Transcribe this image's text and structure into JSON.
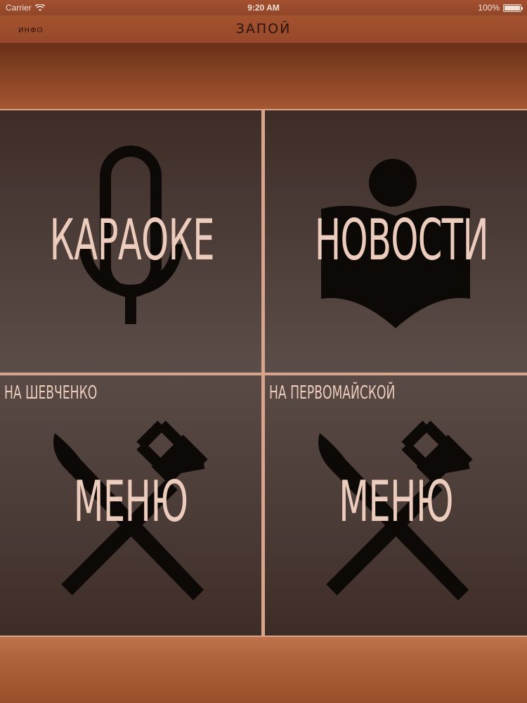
{
  "status_bar": {
    "carrier": "Carrier",
    "time": "9:20 AM",
    "battery": "100%",
    "battery_level": 1.0
  },
  "nav_bar": {
    "left_label": "ИНФО",
    "title": "ЗАПОЙ"
  },
  "tiles": [
    {
      "label": "КАРАОКЕ",
      "icon": "microphone-icon"
    },
    {
      "label": "НОВОСТИ",
      "icon": "news-reader-icon"
    },
    {
      "label": "МЕНЮ",
      "sublabel": "НА ШЕВЧЕНКО",
      "icon": "knife-fork-icon"
    },
    {
      "label": "МЕНЮ",
      "sublabel": "НА ПЕРВОМАЙСКОЙ",
      "icon": "knife-fork-icon"
    }
  ],
  "colors": {
    "accent": "#a1532f",
    "tile_text": "#ecccbc",
    "icon": "#0d0907",
    "divider": "#d7a58c"
  }
}
